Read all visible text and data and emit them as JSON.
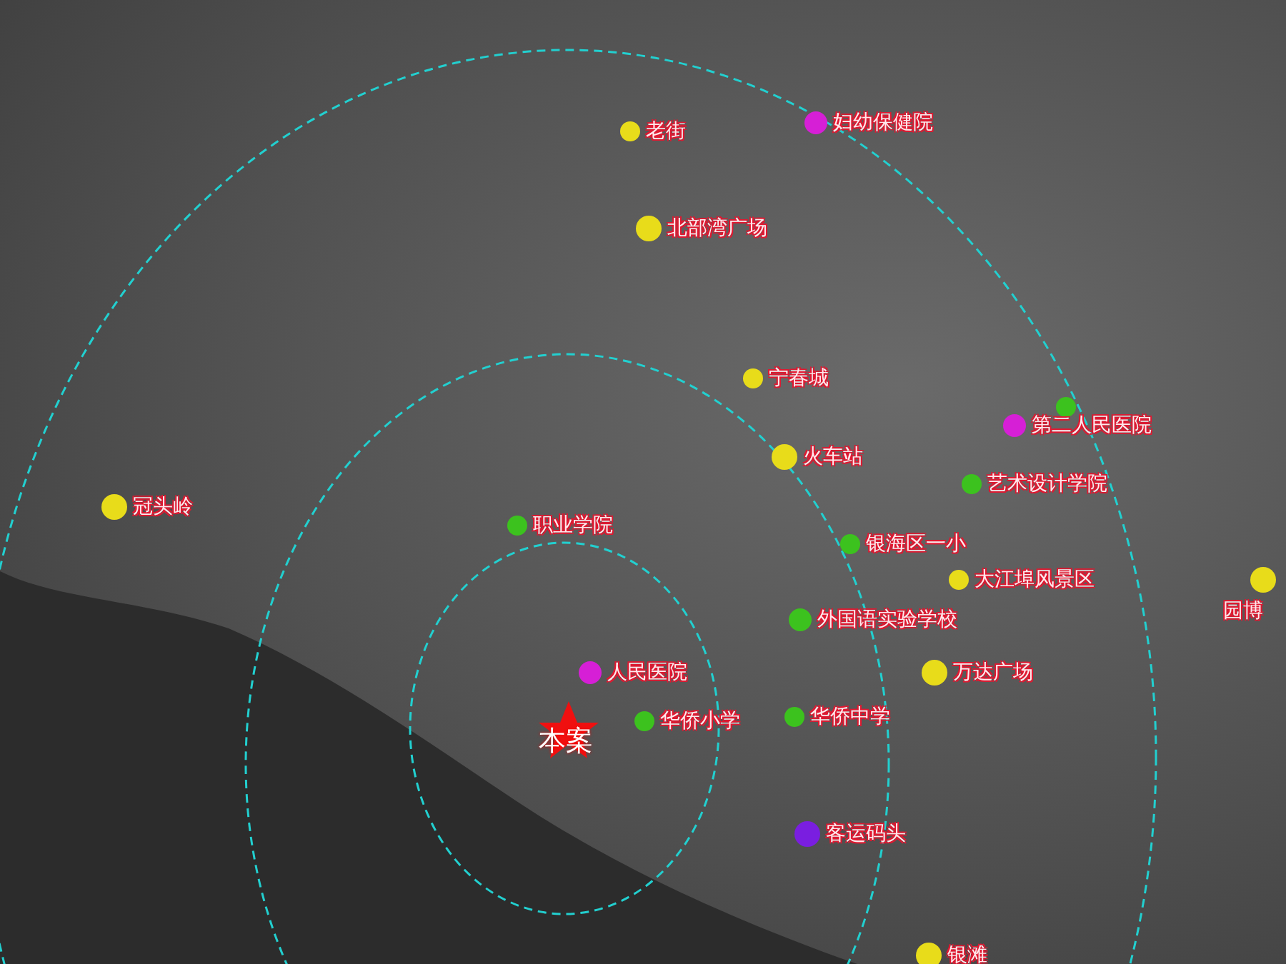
{
  "map": {
    "pins": [
      {
        "label": "老街",
        "color": "#e8dc1a"
      },
      {
        "label": "妇幼保健院",
        "color": "#d61fd6"
      },
      {
        "label": "北部湾广场",
        "color": "#e8dc1a"
      },
      {
        "label": "宁春城",
        "color": "#e8dc1a"
      },
      {
        "label": "火车站",
        "color": "#e8dc1a"
      },
      {
        "color": "#3cc21e"
      },
      {
        "label": "第二人民医院",
        "color": "#d61fd6"
      },
      {
        "label": "艺术设计学院",
        "color": "#3cc21e"
      },
      {
        "label": "冠头岭",
        "color": "#e8dc1a"
      },
      {
        "label": "职业学院",
        "color": "#3cc21e"
      },
      {
        "label": "银海区一小",
        "color": "#3cc21e"
      },
      {
        "label": "大江埠风景区",
        "color": "#e8dc1a"
      },
      {
        "label": "园博",
        "color": "#e8dc1a"
      },
      {
        "label": "外国语实验学校",
        "color": "#3cc21e"
      },
      {
        "label": "人民医院",
        "color": "#d61fd6"
      },
      {
        "label": "万达广场",
        "color": "#e8dc1a"
      },
      {
        "label": "华侨小学",
        "color": "#3cc21e"
      },
      {
        "label": "华侨中学",
        "color": "#3cc21e"
      },
      {
        "label": "客运码头",
        "color": "#7a1ee0"
      },
      {
        "label": "银滩",
        "color": "#e8dc1a"
      }
    ],
    "site": {
      "label": "本案"
    }
  }
}
